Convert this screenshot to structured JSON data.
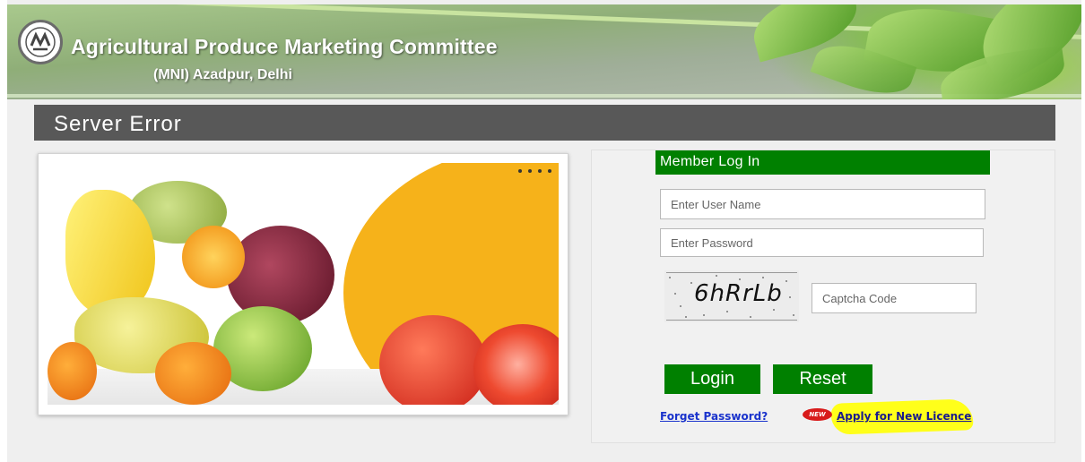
{
  "header": {
    "title": "Agricultural Produce Marketing Committee",
    "subtitle": "(MNI) Azadpur, Delhi"
  },
  "page": {
    "title": "Server Error"
  },
  "login": {
    "heading": "Member Log In",
    "username_placeholder": "Enter User Name",
    "password_placeholder": "Enter Password",
    "captcha_text": "6hRrLb",
    "captcha_placeholder": "Captcha Code",
    "login_label": "Login",
    "reset_label": "Reset",
    "forgot_label": "Forget Password?",
    "new_badge": "NEW",
    "apply_label": "Apply for New Licence"
  },
  "colors": {
    "accent_green": "#008000",
    "title_bar": "#585858",
    "highlight": "#ffff1a",
    "link": "#1a33cc"
  },
  "icons": [
    "apmc-logo-icon",
    "new-badge-icon",
    "slider-dots-icon"
  ]
}
